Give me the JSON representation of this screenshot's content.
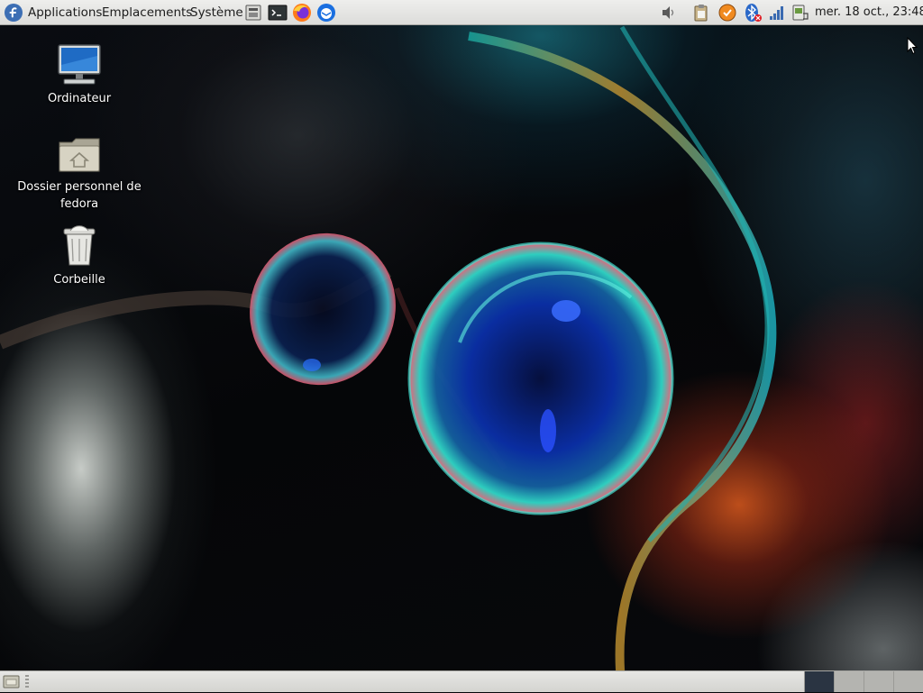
{
  "top_panel": {
    "menus": {
      "applications": "Applications",
      "places": "Emplacements",
      "system": "Système"
    },
    "clock": "mer. 18 oct., 23:48"
  },
  "desktop": {
    "icons": [
      {
        "label": "Ordinateur"
      },
      {
        "label": "Dossier personnel de fedora"
      },
      {
        "label": "Corbeille"
      }
    ]
  },
  "bottom_panel": {
    "workspaces": 4,
    "active_workspace": 1
  },
  "icons": {
    "distro": "fedora-logo-icon",
    "launchers": [
      "screenshot-icon",
      "terminal-icon",
      "firefox-icon",
      "thunderbird-icon"
    ],
    "tray": [
      "volume-icon",
      "clipboard-icon",
      "update-notifier-icon",
      "bluetooth-disabled-icon",
      "network-signal-icon",
      "power-icon"
    ]
  },
  "colors": {
    "panel": "#e6e6e4",
    "fedora_blue": "#3c6eb4",
    "active_workspace": "#2a3442"
  }
}
